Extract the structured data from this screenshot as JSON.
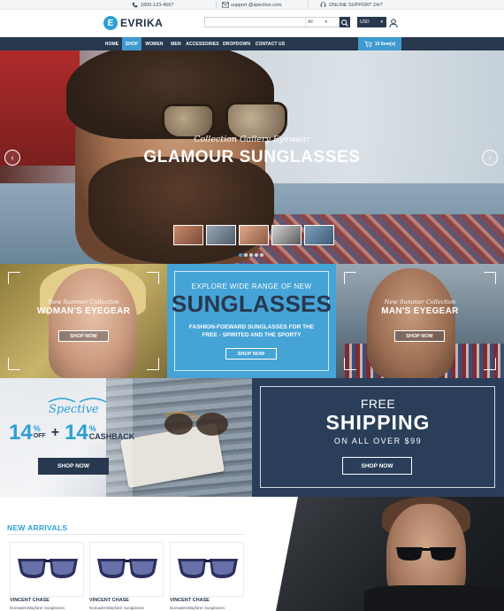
{
  "topbar": {
    "phone": "1800-123-4567",
    "email": "support @spective.com",
    "support": "ONLINE SUPPORT 24/7"
  },
  "header": {
    "logo_mark": "E",
    "logo_text": "EVRIKA",
    "search_placeholder": "",
    "search_category": "All",
    "currency": "USD"
  },
  "nav": {
    "items": [
      "HOME",
      "SHOP",
      "WOMEN",
      "MEN",
      "ACCESSORIES",
      "DROPDOWN",
      "CONTACT US"
    ],
    "active": "SHOP",
    "cart_label": "10 Item(s)"
  },
  "hero": {
    "subtitle": "Collection Gallery Eyewear",
    "title": "GLAMOUR SUNGLASSES",
    "prev_icon": "chevron-left-icon",
    "next_icon": "chevron-right-icon",
    "slide_count": 5,
    "active_slide": 1
  },
  "banner_woman": {
    "subtitle": "New Summer Collection",
    "title": "WOMAN'S EYEGEAR",
    "button": "SHOP NOW"
  },
  "banner_center": {
    "top": "EXPLORE WIDE RANGE OF NEW",
    "big": "SUNGLASSES",
    "desc": "FASHION-FOEWARD SUNGLASSES FOR THE FREE - SPIRITED AND THE SPORTY",
    "button": "SHOP NOW"
  },
  "banner_man": {
    "subtitle": "New Summer Collection",
    "title": "MAN'S EYEGEAR",
    "button": "SHOP NOW"
  },
  "promo": {
    "brand": "Spective",
    "percent_a": "14",
    "unit_a": "%",
    "label_a": "OFF",
    "plus": "+",
    "percent_b": "14",
    "unit_b": "%",
    "label_b": "CASHBACK",
    "button": "SHOP NOW"
  },
  "shipping": {
    "free": "FREE",
    "big": "SHIPPING",
    "sub": "ON ALL OVER $99",
    "button": "SHOP NOW"
  },
  "arrivals": {
    "title": "NEW ARRIVALS",
    "products": [
      {
        "brand": "VINCENT CHASE",
        "name": "NomadenWayfarer Sunglasses"
      },
      {
        "brand": "VINCENT CHASE",
        "name": "NomadenWayfarer Sunglasses"
      },
      {
        "brand": "VINCENT CHASE",
        "name": "NomadenWayfarer Sunglasses"
      }
    ]
  },
  "colors": {
    "navy": "#27384f",
    "accent": "#3f9ad0",
    "brand_blue": "#2a9fd6"
  }
}
